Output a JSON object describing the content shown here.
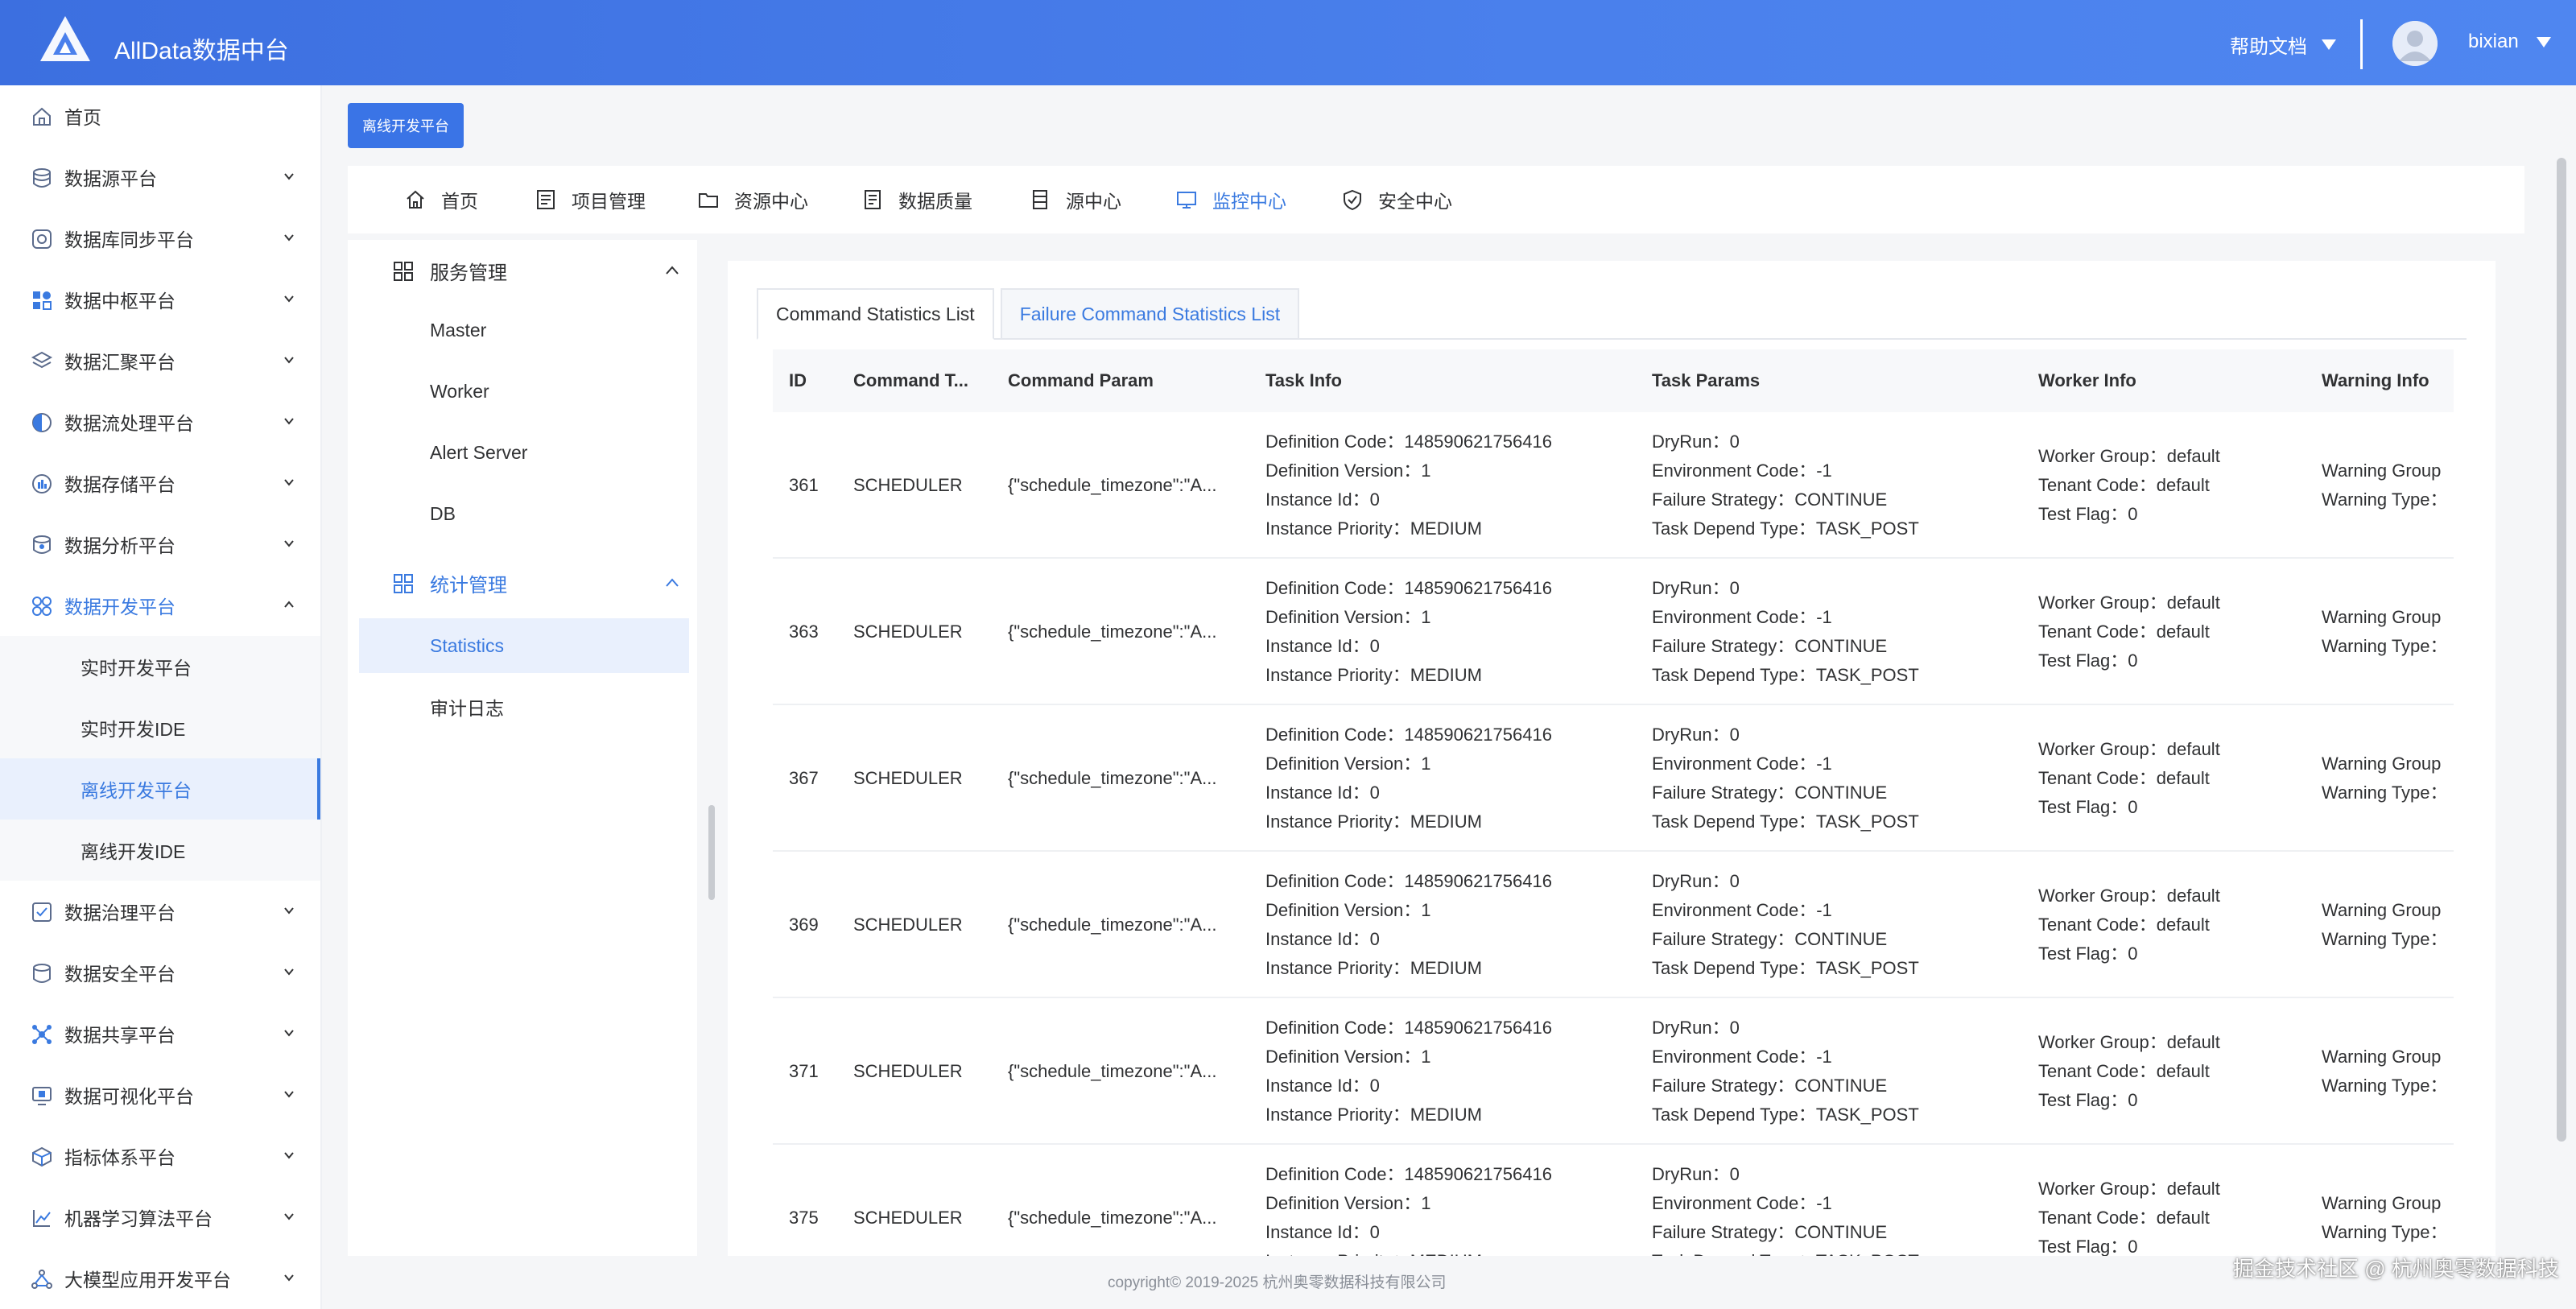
{
  "header": {
    "app_title": "AllData数据中台",
    "help_label": "帮助文档",
    "user_name": "bixian"
  },
  "sidebar": {
    "items": [
      {
        "label": "首页",
        "icon": "home-icon"
      },
      {
        "label": "数据源平台",
        "icon": "database-icon"
      },
      {
        "label": "数据库同步平台",
        "icon": "sync-icon"
      },
      {
        "label": "数据中枢平台",
        "icon": "hub-icon"
      },
      {
        "label": "数据汇聚平台",
        "icon": "layers-icon"
      },
      {
        "label": "数据流处理平台",
        "icon": "stream-icon"
      },
      {
        "label": "数据存储平台",
        "icon": "storage-icon"
      },
      {
        "label": "数据分析平台",
        "icon": "analysis-icon"
      },
      {
        "label": "数据开发平台",
        "icon": "dev-icon"
      }
    ],
    "sub_items": [
      {
        "label": "实时开发平台"
      },
      {
        "label": "实时开发IDE"
      },
      {
        "label": "离线开发平台"
      },
      {
        "label": "离线开发IDE"
      }
    ],
    "items_after": [
      {
        "label": "数据治理平台",
        "icon": "governance-icon"
      },
      {
        "label": "数据安全平台",
        "icon": "security-icon"
      },
      {
        "label": "数据共享平台",
        "icon": "share-icon"
      },
      {
        "label": "数据可视化平台",
        "icon": "visualization-icon"
      },
      {
        "label": "指标体系平台",
        "icon": "metrics-icon"
      },
      {
        "label": "机器学习算法平台",
        "icon": "ml-icon"
      },
      {
        "label": "大模型应用开发平台",
        "icon": "llm-icon"
      }
    ]
  },
  "tag_button": "离线开发平台",
  "topnav": {
    "items": [
      {
        "label": "首页"
      },
      {
        "label": "项目管理"
      },
      {
        "label": "资源中心"
      },
      {
        "label": "数据质量"
      },
      {
        "label": "源中心"
      },
      {
        "label": "监控中心"
      },
      {
        "label": "安全中心"
      }
    ],
    "active_index": 5
  },
  "subside": {
    "group1": "服务管理",
    "group1_items": [
      "Master",
      "Worker",
      "Alert Server",
      "DB"
    ],
    "group2": "统计管理",
    "group2_items": [
      "Statistics",
      "审计日志"
    ]
  },
  "tabs": {
    "active": "Command Statistics List",
    "inactive": "Failure Command Statistics List"
  },
  "table": {
    "columns": [
      "ID",
      "Command T...",
      "Command Param",
      "Task Info",
      "Task Params",
      "Worker Info",
      "Warning Info"
    ],
    "rows": [
      {
        "id": "361",
        "type": "SCHEDULER",
        "param": "{\"schedule_timezone\":\"A...",
        "task_info": [
          "Definition Code：148590621756416",
          "Definition Version：1",
          "Instance Id：0",
          "Instance Priority：MEDIUM"
        ],
        "task_params": [
          "DryRun：0",
          "Environment Code：-1",
          "Failure Strategy：CONTINUE",
          "Task Depend Type：TASK_POST"
        ],
        "worker_info": [
          "Worker Group：default",
          "Tenant Code：default",
          "Test Flag：0"
        ],
        "warning_info": [
          "Warning Group",
          "Warning Type："
        ]
      },
      {
        "id": "363",
        "type": "SCHEDULER",
        "param": "{\"schedule_timezone\":\"A...",
        "task_info": [
          "Definition Code：148590621756416",
          "Definition Version：1",
          "Instance Id：0",
          "Instance Priority：MEDIUM"
        ],
        "task_params": [
          "DryRun：0",
          "Environment Code：-1",
          "Failure Strategy：CONTINUE",
          "Task Depend Type：TASK_POST"
        ],
        "worker_info": [
          "Worker Group：default",
          "Tenant Code：default",
          "Test Flag：0"
        ],
        "warning_info": [
          "Warning Group",
          "Warning Type："
        ]
      },
      {
        "id": "367",
        "type": "SCHEDULER",
        "param": "{\"schedule_timezone\":\"A...",
        "task_info": [
          "Definition Code：148590621756416",
          "Definition Version：1",
          "Instance Id：0",
          "Instance Priority：MEDIUM"
        ],
        "task_params": [
          "DryRun：0",
          "Environment Code：-1",
          "Failure Strategy：CONTINUE",
          "Task Depend Type：TASK_POST"
        ],
        "worker_info": [
          "Worker Group：default",
          "Tenant Code：default",
          "Test Flag：0"
        ],
        "warning_info": [
          "Warning Group",
          "Warning Type："
        ]
      },
      {
        "id": "369",
        "type": "SCHEDULER",
        "param": "{\"schedule_timezone\":\"A...",
        "task_info": [
          "Definition Code：148590621756416",
          "Definition Version：1",
          "Instance Id：0",
          "Instance Priority：MEDIUM"
        ],
        "task_params": [
          "DryRun：0",
          "Environment Code：-1",
          "Failure Strategy：CONTINUE",
          "Task Depend Type：TASK_POST"
        ],
        "worker_info": [
          "Worker Group：default",
          "Tenant Code：default",
          "Test Flag：0"
        ],
        "warning_info": [
          "Warning Group",
          "Warning Type："
        ]
      },
      {
        "id": "371",
        "type": "SCHEDULER",
        "param": "{\"schedule_timezone\":\"A...",
        "task_info": [
          "Definition Code：148590621756416",
          "Definition Version：1",
          "Instance Id：0",
          "Instance Priority：MEDIUM"
        ],
        "task_params": [
          "DryRun：0",
          "Environment Code：-1",
          "Failure Strategy：CONTINUE",
          "Task Depend Type：TASK_POST"
        ],
        "worker_info": [
          "Worker Group：default",
          "Tenant Code：default",
          "Test Flag：0"
        ],
        "warning_info": [
          "Warning Group",
          "Warning Type："
        ]
      },
      {
        "id": "375",
        "type": "SCHEDULER",
        "param": "{\"schedule_timezone\":\"A...",
        "task_info": [
          "Definition Code：148590621756416",
          "Definition Version：1",
          "Instance Id：0",
          "Instance Priority：MEDIUM"
        ],
        "task_params": [
          "DryRun：0",
          "Environment Code：-1",
          "Failure Strategy：CONTINUE",
          "Task Depend Type：TASK_POST"
        ],
        "worker_info": [
          "Worker Group：default",
          "Tenant Code：default",
          "Test Flag：0"
        ],
        "warning_info": [
          "Warning Group",
          "Warning Type："
        ]
      }
    ]
  },
  "footer": "copyright© 2019-2025 杭州奥零数据科技有限公司",
  "watermark": "掘金技术社区 @ 杭州奥零数据科技",
  "colors": {
    "accent": "#3a7ae0",
    "header": "#4a80ec"
  }
}
